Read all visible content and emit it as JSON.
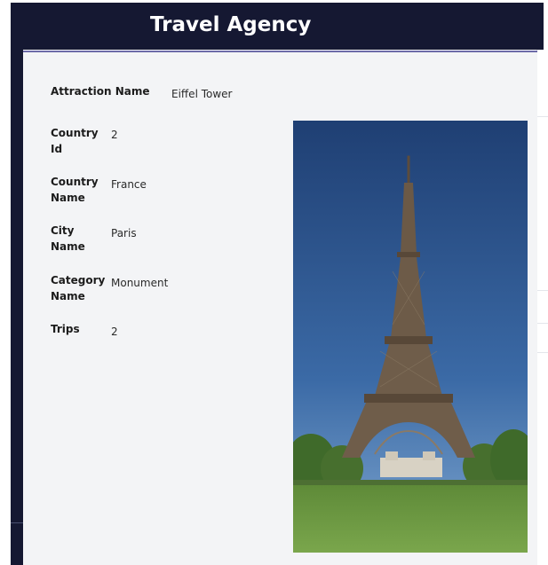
{
  "app": {
    "title": "Travel Agency"
  },
  "attraction": {
    "fields": [
      {
        "label": "Attraction Name",
        "value": "Eiffel Tower"
      },
      {
        "label": "Country Id",
        "value": "2"
      },
      {
        "label": "Country Name",
        "value": "France"
      },
      {
        "label": "City Name",
        "value": "Paris"
      },
      {
        "label": "Category Name",
        "value": "Monument"
      },
      {
        "label": "Trips",
        "value": "2"
      }
    ],
    "photo_icon": "eiffel-tower-photo"
  },
  "colors": {
    "header_bg": "#151832",
    "modal_bg": "#f3f4f6",
    "accent_border": "#6c6aa8",
    "sky": "#2f5b94",
    "grass": "#6f9a45",
    "tower": "#6a5a48"
  }
}
